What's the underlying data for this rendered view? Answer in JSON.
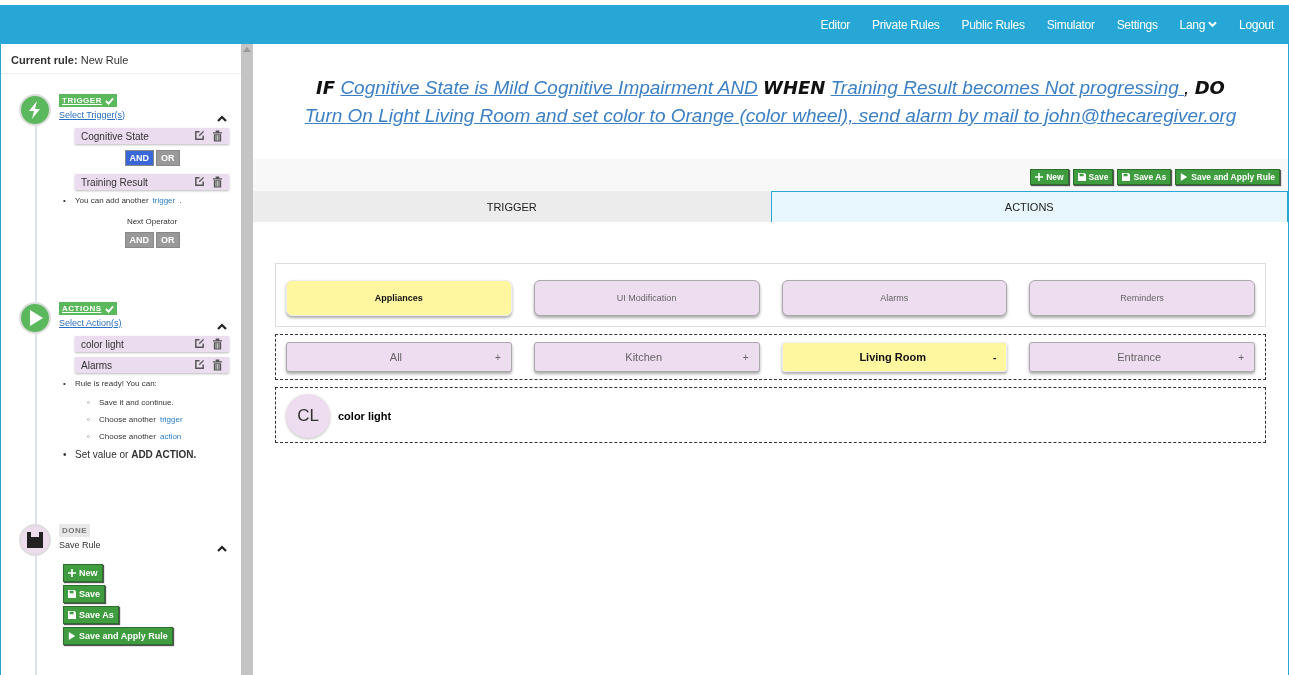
{
  "nav": [
    {
      "label": "Editor",
      "dropdown": false
    },
    {
      "label": "Private Rules",
      "dropdown": false
    },
    {
      "label": "Public Rules",
      "dropdown": false
    },
    {
      "label": "Simulator",
      "dropdown": false
    },
    {
      "label": "Settings",
      "dropdown": false
    },
    {
      "label": "Lang",
      "dropdown": true
    },
    {
      "label": "Logout",
      "dropdown": false
    }
  ],
  "sidebar": {
    "current_rule_label": "Current rule:",
    "current_rule": "New Rule",
    "trigger_step": {
      "badge": "TRIGGER",
      "complete": true,
      "link": "Select Trigger(s)",
      "items": [
        "Cognitive State",
        "Training Result"
      ],
      "operator": [
        {
          "label": "AND",
          "selected": true
        },
        {
          "label": "OR",
          "selected": false
        }
      ],
      "hint": {
        "bullet": "•",
        "text": "You can add another",
        "link": "trigger",
        "after": "."
      },
      "next_operator_label": "Next Operator",
      "next_operator": [
        {
          "label": "AND",
          "selected": false
        },
        {
          "label": "OR",
          "selected": false
        }
      ]
    },
    "actions_step": {
      "badge": "ACTIONS",
      "complete": true,
      "link": "Select Action(s)",
      "items": [
        "color light",
        "Alarms"
      ],
      "ready_bullet": "•",
      "ready": "Rule is ready! You can:",
      "options": [
        {
          "bullet": "◦",
          "text": "Save it and continue."
        },
        {
          "bullet": "◦",
          "text": "Choose another",
          "link": "trigger"
        },
        {
          "bullet": "◦",
          "text": "Choose another",
          "link": "action"
        }
      ],
      "final_bullet": "•",
      "final": "Set value or **ADD ACTION.**"
    },
    "done_step": {
      "badge": "DONE",
      "complete": false,
      "subtitle": "Save Rule",
      "buttons": [
        {
          "label": "New",
          "kind": "new"
        },
        {
          "label": "Save",
          "kind": "save"
        },
        {
          "label": "Save As",
          "kind": "save"
        },
        {
          "label": "Save and Apply Rule",
          "kind": "apply"
        }
      ]
    }
  },
  "main": {
    "summary": [
      {
        "kind": "keyword",
        "text": "IF"
      },
      {
        "kind": "link",
        "text": "Cognitive State is Mild Cognitive Impairment AND"
      },
      {
        "kind": "keyword",
        "text": "WHEN"
      },
      {
        "kind": "link",
        "text": "Training Result becomes Not progressing "
      },
      {
        "kind": "plain",
        "text": ","
      },
      {
        "kind": "keyword",
        "text": "DO"
      },
      {
        "kind": "link",
        "text": "Turn On Light Living Room and set color to Orange (color wheel), send alarm by mail to john@thecaregiver.org"
      }
    ],
    "toolbar": [
      {
        "label": "New",
        "kind": "new"
      },
      {
        "label": "Save",
        "kind": "save"
      },
      {
        "label": "Save As",
        "kind": "save"
      },
      {
        "label": "Save and Apply Rule",
        "kind": "apply"
      }
    ],
    "tabs": [
      {
        "label": "TRIGGER",
        "selected": false
      },
      {
        "label": "ACTIONS",
        "selected": true
      }
    ],
    "categories": [
      {
        "label": "Appliances",
        "selected": true
      },
      {
        "label": "UI Modification",
        "selected": false
      },
      {
        "label": "Alarms",
        "selected": false
      },
      {
        "label": "Reminders",
        "selected": false
      }
    ],
    "rooms": [
      {
        "label": "All",
        "selected": false,
        "toggle": "+"
      },
      {
        "label": "Kitchen",
        "selected": false,
        "toggle": "+"
      },
      {
        "label": "Living Room",
        "selected": true,
        "toggle": "-"
      },
      {
        "label": "Entrance",
        "selected": false,
        "toggle": "+"
      }
    ],
    "devices": [
      {
        "initials": "CL",
        "name": "color light"
      }
    ]
  }
}
